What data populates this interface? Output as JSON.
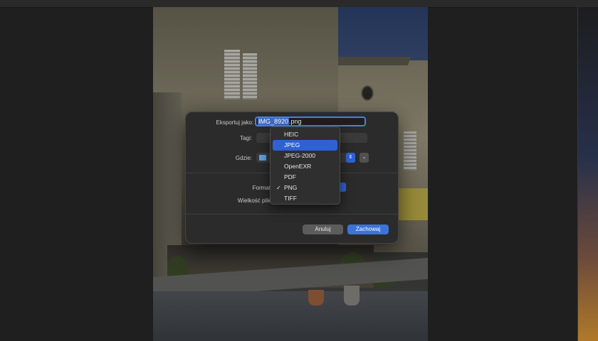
{
  "dialog": {
    "export_as_label": "Eksportuj jako:",
    "filename_selected": "IMG_8920",
    "filename_ext": ".png",
    "tags_label": "Tagi:",
    "where_label": "Gdzie:",
    "format_label": "Format",
    "file_size_label": "Wielkość plik",
    "cancel_label": "Anuluj",
    "save_label": "Zachowaj"
  },
  "format_menu": {
    "items": [
      "HEIC",
      "JPEG",
      "JPEG-2000",
      "OpenEXR",
      "PDF",
      "PNG",
      "TIFF"
    ],
    "highlighted": "JPEG",
    "checked": "PNG",
    "check_glyph": "✓"
  },
  "colors": {
    "accent": "#3c73d8",
    "dialog_bg": "#2b2b2b"
  }
}
